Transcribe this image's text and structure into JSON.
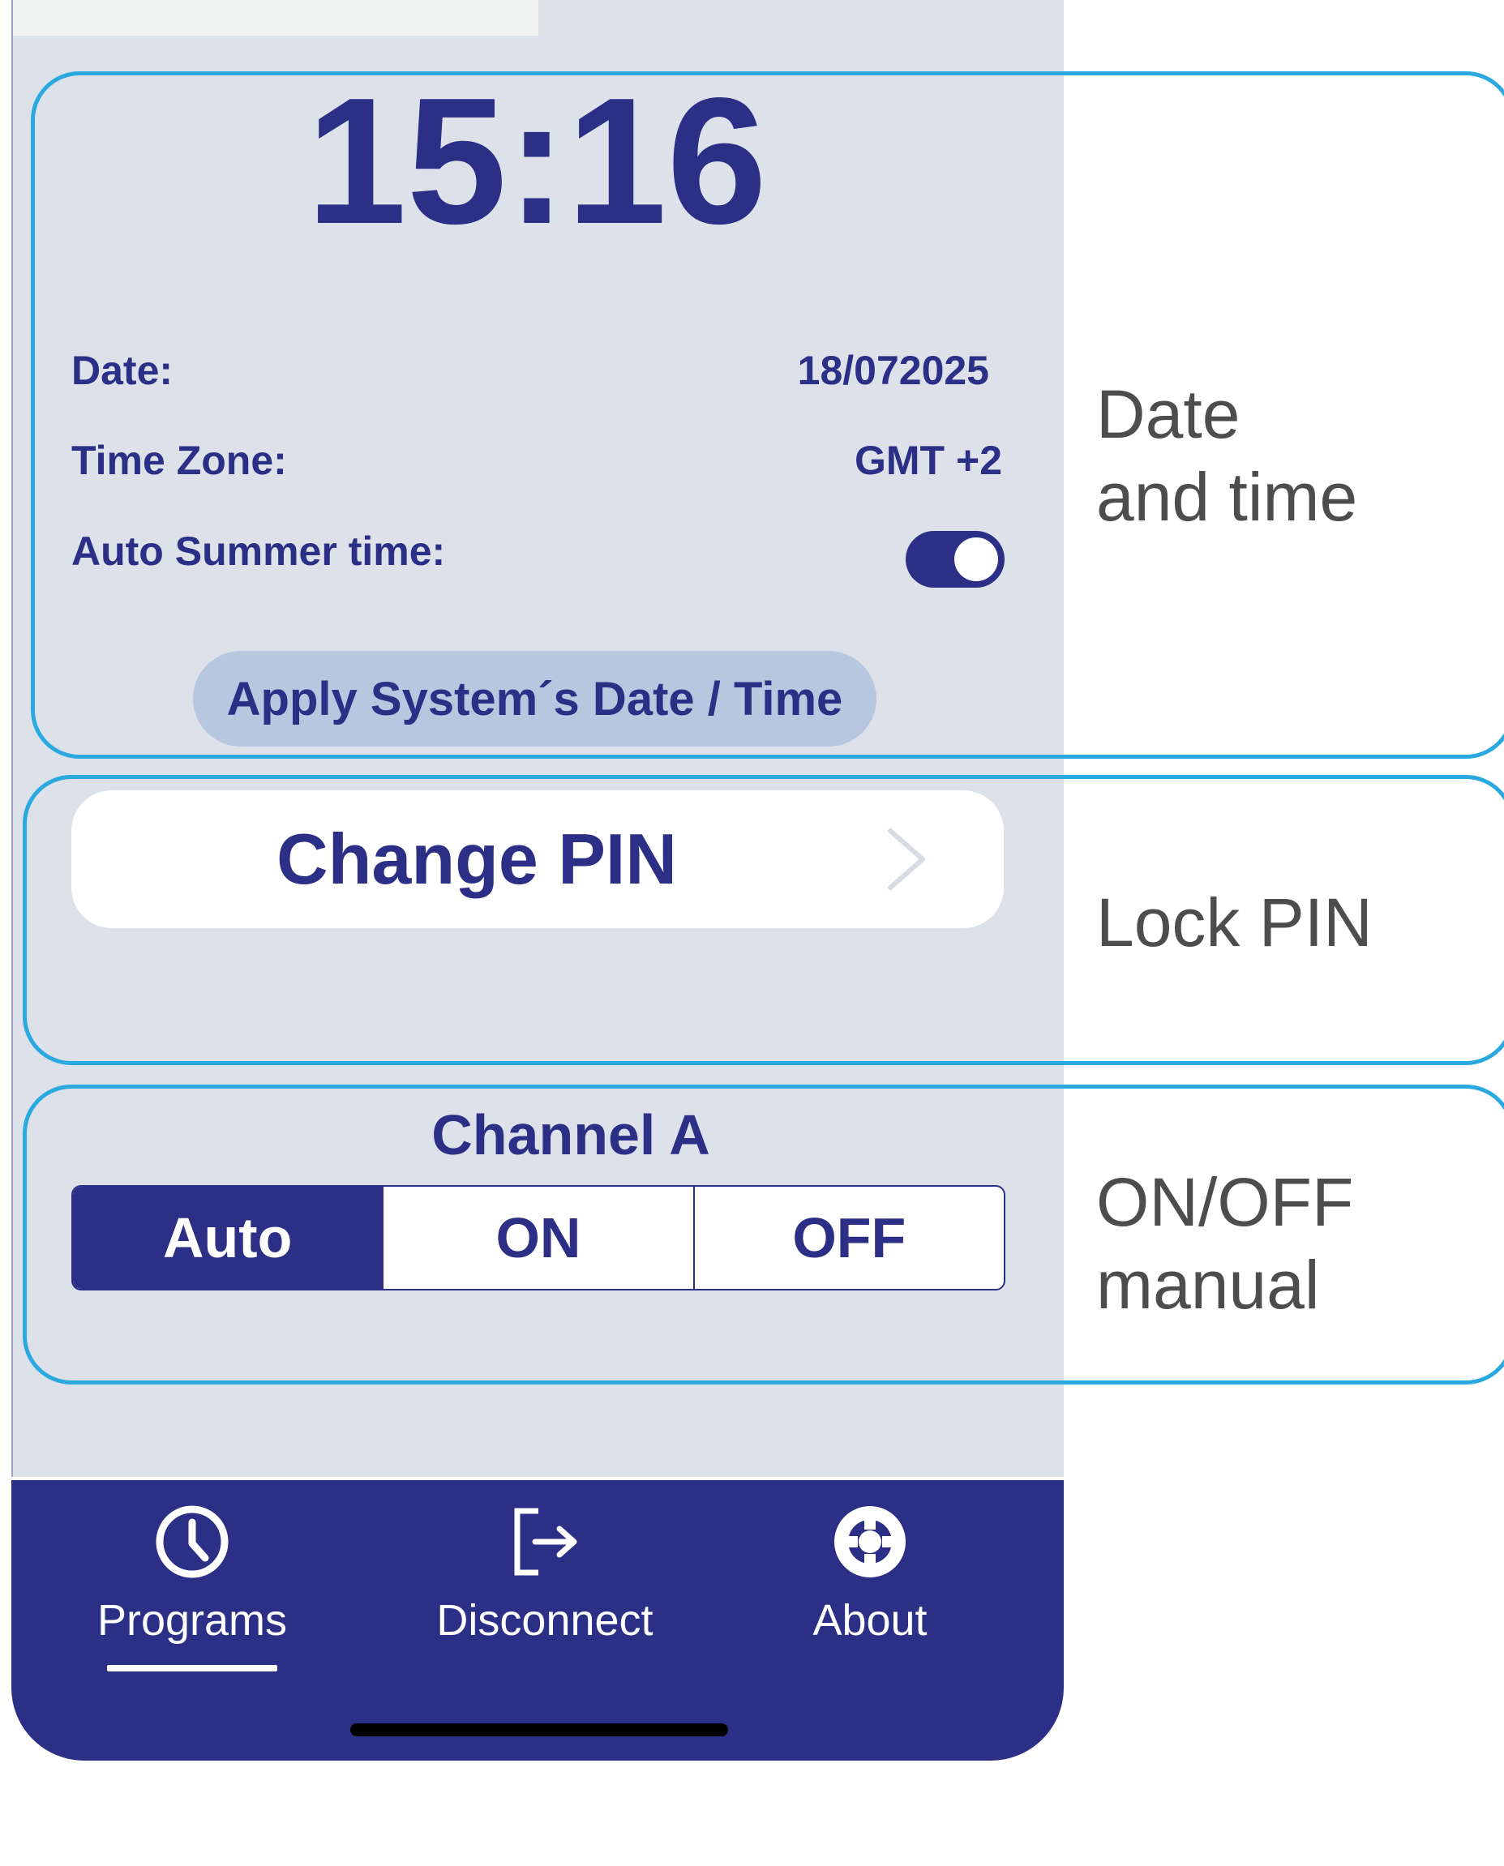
{
  "clock": {
    "time": "15:16"
  },
  "settings": {
    "date_label": "Date:",
    "date_value": "18/072025",
    "timezone_label": "Time Zone:",
    "timezone_value": "GMT +2",
    "summer_label": "Auto Summer time:",
    "summer_enabled": true,
    "apply_button": "Apply System´s Date / Time"
  },
  "pin": {
    "button_label": "Change PIN"
  },
  "channel": {
    "title": "Channel A",
    "options": [
      "Auto",
      "ON",
      "OFF"
    ],
    "selected": "Auto"
  },
  "tabbar": {
    "tabs": [
      {
        "label": "Programs",
        "icon": "clock-icon",
        "active": true
      },
      {
        "label": "Disconnect",
        "icon": "logout-icon",
        "active": false
      },
      {
        "label": "About",
        "icon": "lifebuoy-icon",
        "active": false
      }
    ]
  },
  "annotations": {
    "date_time_line1": "Date",
    "date_time_line2": "and time",
    "lock_pin": "Lock PIN",
    "onoff_line1": "ON/OFF",
    "onoff_line2": "manual"
  },
  "colors": {
    "primary": "#2b2f86",
    "background": "#dde2ea",
    "apply_button_bg": "#b7c7df",
    "callout_border": "#2aa8e0",
    "annotation_text": "#4d4d4d"
  }
}
